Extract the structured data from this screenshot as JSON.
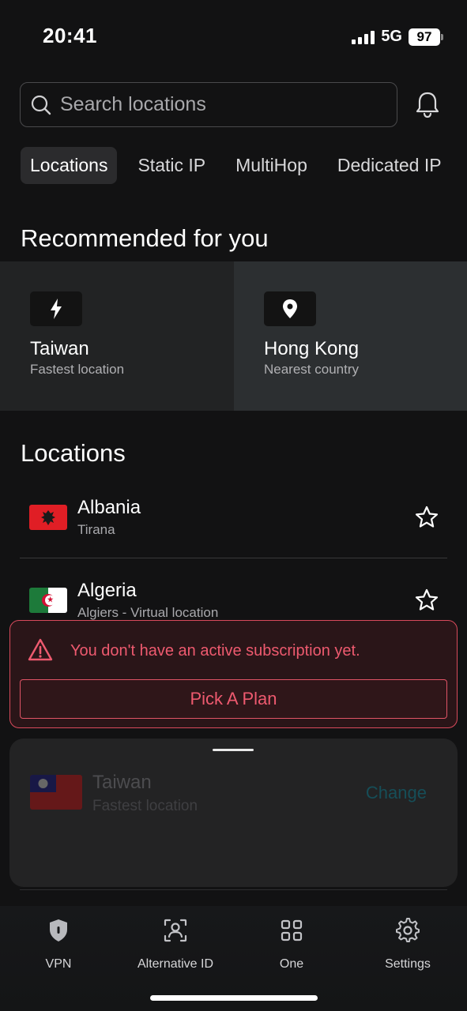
{
  "status_bar": {
    "time": "20:41",
    "network": "5G",
    "battery": "97"
  },
  "search": {
    "placeholder": "Search locations",
    "icon": "search-icon"
  },
  "header": {
    "notification_icon": "bell-icon"
  },
  "tabs": [
    {
      "label": "Locations",
      "active": true
    },
    {
      "label": "Static IP",
      "active": false
    },
    {
      "label": "MultiHop",
      "active": false
    },
    {
      "label": "Dedicated IP",
      "active": false
    }
  ],
  "recommended": {
    "title": "Recommended for you",
    "cards": [
      {
        "name": "Taiwan",
        "subtitle": "Fastest location",
        "icon": "lightning-icon"
      },
      {
        "name": "Hong Kong",
        "subtitle": "Nearest country",
        "icon": "location-pin-icon"
      }
    ]
  },
  "locations": {
    "title": "Locations",
    "items": [
      {
        "country": "Albania",
        "city": "Tirana",
        "flag": "albania-flag-icon",
        "favorite_icon": "star-icon"
      },
      {
        "country": "Algeria",
        "city": "Algiers - Virtual location",
        "flag": "algeria-flag-icon",
        "favorite_icon": "star-icon"
      }
    ]
  },
  "alert": {
    "message": "You don't have an active subscription yet.",
    "button": "Pick A Plan",
    "icon": "warning-icon",
    "color": "#ee5a6f"
  },
  "connection_sheet": {
    "country": "Taiwan",
    "subtitle": "Fastest location",
    "action": "Change",
    "flag": "taiwan-flag-icon"
  },
  "tab_bar": [
    {
      "label": "VPN",
      "icon": "shield-icon"
    },
    {
      "label": "Alternative ID",
      "icon": "user-scan-icon"
    },
    {
      "label": "One",
      "icon": "grid-icon"
    },
    {
      "label": "Settings",
      "icon": "gear-icon"
    }
  ],
  "colors": {
    "background": "#121213",
    "accent_error": "#ee5a6f",
    "link_muted": "#164e58"
  }
}
